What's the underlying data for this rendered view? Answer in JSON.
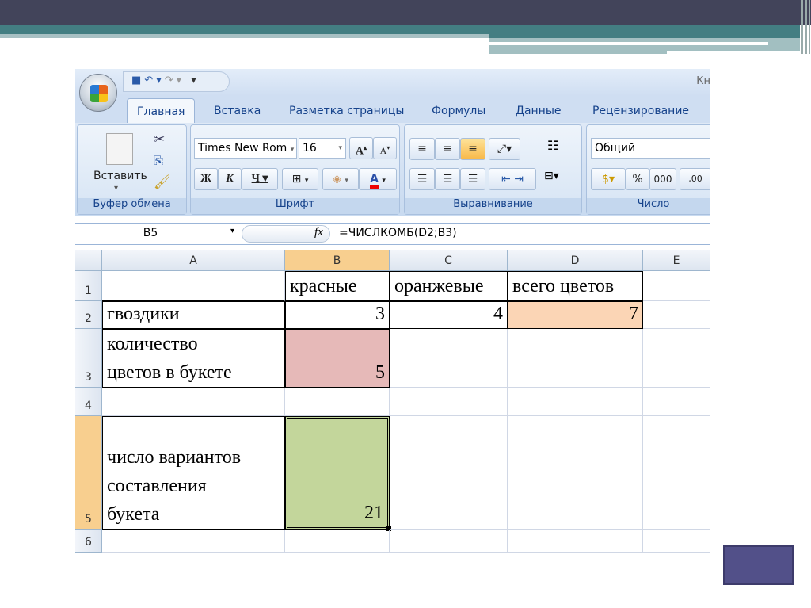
{
  "window_title": "Кн",
  "tabs": [
    "Главная",
    "Вставка",
    "Разметка страницы",
    "Формулы",
    "Данные",
    "Рецензирование"
  ],
  "ribbon": {
    "clipboard": {
      "paste": "Вставить",
      "label": "Буфер обмена"
    },
    "font": {
      "name": "Times New Rom",
      "size": "16",
      "bold": "Ж",
      "italic": "К",
      "underline": "Ч",
      "label": "Шрифт"
    },
    "alignment": {
      "label": "Выравнивание"
    },
    "number": {
      "format": "Общий",
      "percent": "%",
      "thousands": "000",
      "decimals": ",00",
      "label": "Число"
    }
  },
  "formula_bar": {
    "cell": "B5",
    "fx": "fx",
    "formula": "=ЧИСЛКОМБ(D2;B3)"
  },
  "columns": [
    "A",
    "B",
    "C",
    "D",
    "E"
  ],
  "rows": [
    "1",
    "2",
    "3",
    "4",
    "5",
    "6"
  ],
  "cells": {
    "B1": "красные",
    "C1": "оранжевые",
    "D1": "всего цветов",
    "A2": "гвоздики",
    "B2": "3",
    "C2": "4",
    "D2": "7",
    "A3a": "количество",
    "A3b": "цветов в букете",
    "B3": "5",
    "A5a": "число вариантов",
    "A5b": "составления",
    "A5c": "букета",
    "B5": "21"
  },
  "colors": {
    "B3": "#e6b9b8",
    "D2": "#fbd5b5",
    "B5": "#c3d69b",
    "selected_header": "#f8cf8f"
  }
}
